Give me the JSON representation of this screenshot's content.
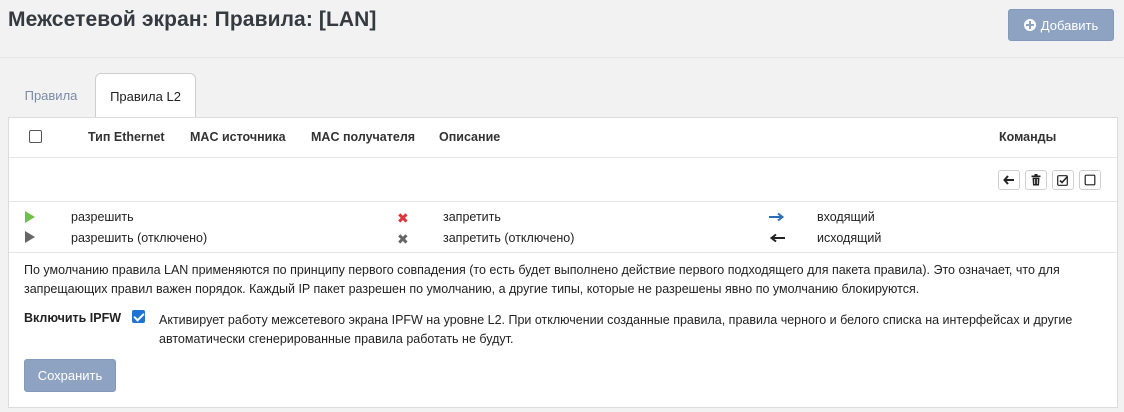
{
  "header": {
    "title": "Межсетевой экран: Правила: [LAN]",
    "add_label": "Добавить"
  },
  "tabs": [
    {
      "label": "Правила",
      "active": false
    },
    {
      "label": "Правила L2",
      "active": true
    }
  ],
  "table": {
    "columns": [
      "Тип Ethernet",
      "MAC источника",
      "MAC получателя",
      "Описание",
      "Команды"
    ]
  },
  "commands": [
    "arrow-left-icon",
    "trash-icon",
    "check-square-icon",
    "square-icon"
  ],
  "legend": {
    "pass": "разрешить",
    "pass_disabled": "разрешить (отключено)",
    "block": "запретить",
    "block_disabled": "запретить (отключено)",
    "in": "входящий",
    "out": "исходящий"
  },
  "info_text": "По умолчанию правила LAN применяются по принципу первого совпадения (то есть будет выполнено действие первого подходящего для пакета правила). Это означает, что для запрещающих правил важен порядок. Каждый IP пакет разрешен по умолчанию, а другие типы, которые не разрешены явно по умолчанию блокируются.",
  "ipfw": {
    "label": "Включить IPFW",
    "checked": true,
    "description": "Активирует работу межсетевого экрана IPFW на уровне L2. При отключении созданные правила, правила черного и белого списка на интерфейсах и другие автоматически сгенерированные правила работать не будут."
  },
  "save_label": "Сохранить",
  "colors": {
    "button": "#8ea3c2",
    "pass": "#6fbf4f",
    "block": "#d9363e",
    "checkbox": "#1e74d3"
  }
}
